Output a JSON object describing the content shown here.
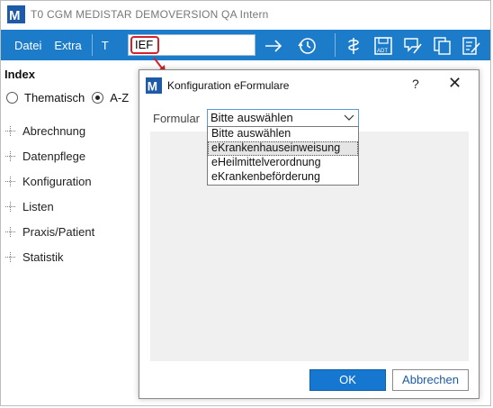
{
  "app": {
    "title": "T0 CGM MEDISTAR DEMOVERSION QA Intern",
    "menu": [
      "Datei",
      "Extra"
    ],
    "toolbar_t": "T",
    "search_value": "IEF",
    "colors": {
      "toolbar": "#1d7cc9",
      "highlight": "#d2232a",
      "ok_button": "#1577d0"
    }
  },
  "sidebar": {
    "title": "Index",
    "radio_thematisch": "Thematisch",
    "radio_az": "A-Z",
    "selected": "A-Z",
    "tree": [
      "Abrechnung",
      "Datenpflege",
      "Konfiguration",
      "Listen",
      "Praxis/Patient",
      "Statistik"
    ]
  },
  "dialog": {
    "title": "Konfiguration eFormulare",
    "help": "?",
    "close": "✕",
    "formular_label": "Formular",
    "selected_option": "Bitte auswählen",
    "options": [
      "Bitte auswählen",
      "eKrankenhauseinweisung",
      "eHeilmittelverordnung",
      "eKrankenbeförderung"
    ],
    "hovered_option": "eKrankenhauseinweisung",
    "ok_label": "OK",
    "cancel_label": "Abbrechen"
  }
}
